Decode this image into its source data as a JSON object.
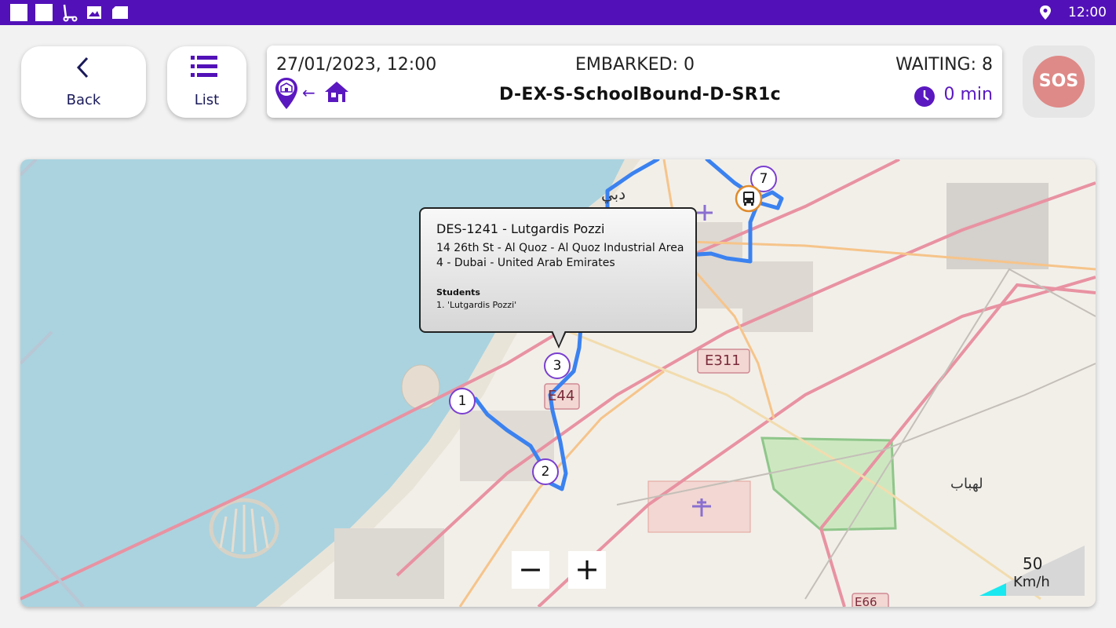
{
  "status_bar": {
    "time": "12:00"
  },
  "toolbar": {
    "back_label": "Back",
    "list_label": "List"
  },
  "trip": {
    "datetime": "27/01/2023, 12:00",
    "embarked": "EMBARKED: 0",
    "waiting": "WAITING: 8",
    "route": "D-EX-S-SchoolBound-D-SR1c",
    "duration": "0 min",
    "direction_arrow": "←"
  },
  "sos": {
    "label": "SOS"
  },
  "map": {
    "labels": {
      "e311": "E311",
      "e44": "E44",
      "e66": "E66",
      "dubai_ar": "دبي",
      "lahbab_ar": "لهباب"
    },
    "popup": {
      "title": "DES-1241 - Lutgardis Pozzi",
      "address_line1": "14 26th St - Al Quoz - Al Quoz Industrial Area",
      "address_line2": "4 - Dubai - United Arab Emirates",
      "students_heading": "Students",
      "student_1": "1. 'Lutgardis Pozzi'"
    },
    "stops": [
      "1",
      "2",
      "3",
      "7"
    ],
    "zoom_out": "−",
    "zoom_in": "+",
    "speed": {
      "value": "50",
      "unit": "Km/h"
    },
    "route_color": "#3b82f0",
    "accent_color": "#5211b8"
  }
}
